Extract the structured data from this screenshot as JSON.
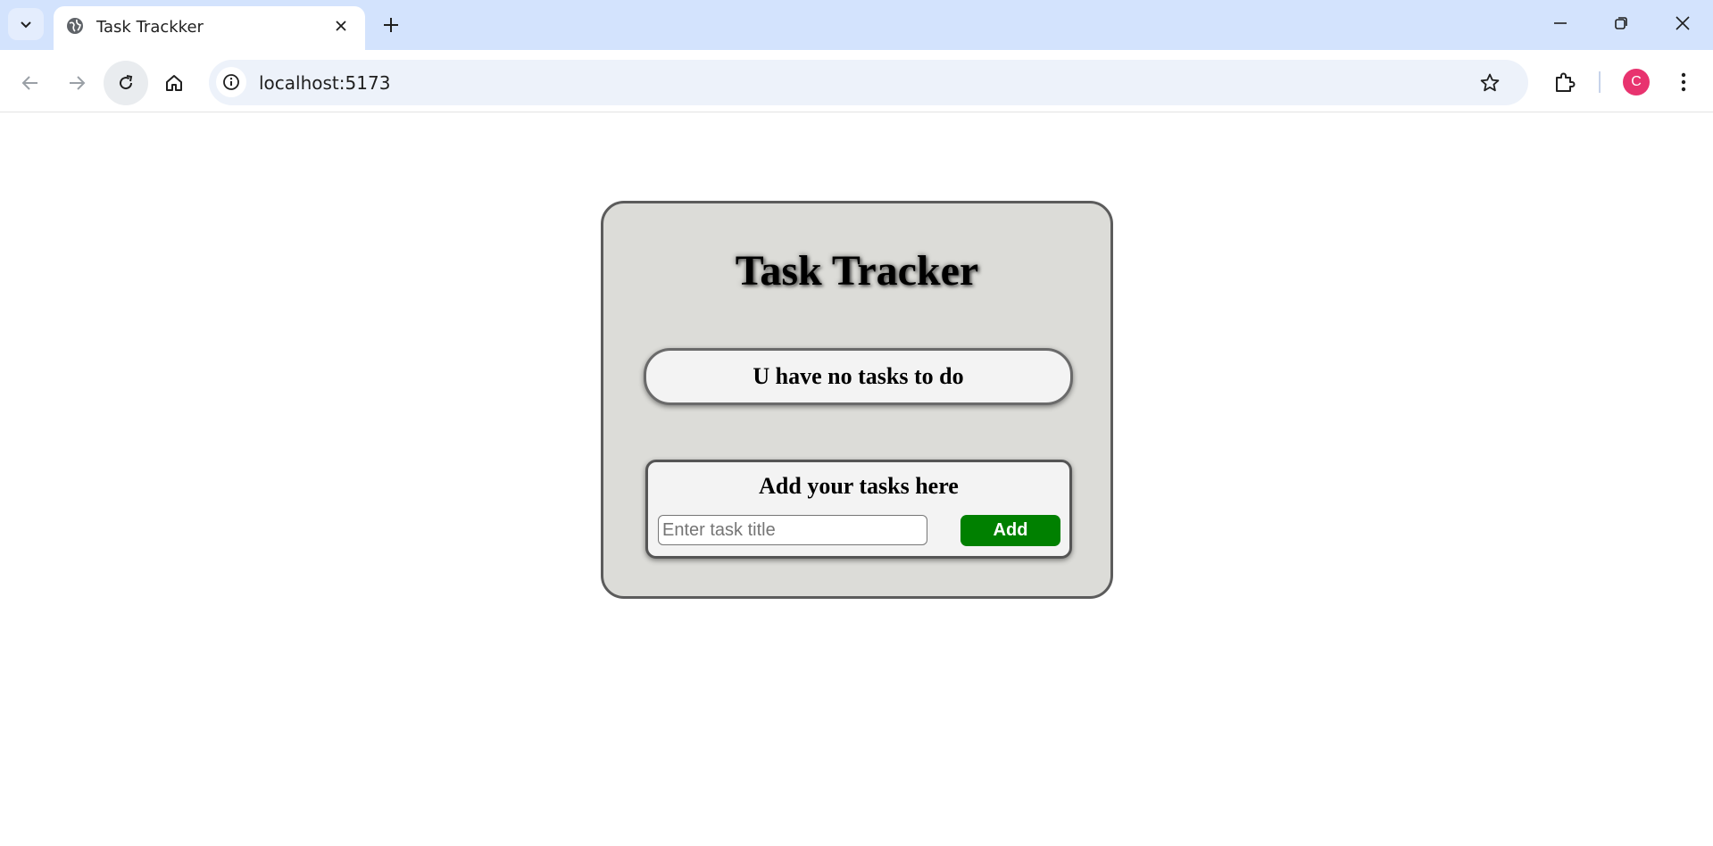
{
  "browser": {
    "tab_title": "Task Trackker",
    "url": "localhost:5173",
    "profile_initial": "C",
    "icons": {
      "tab_search": "chevron-down-icon",
      "favicon": "globe-icon",
      "tab_close": "close-icon",
      "new_tab": "plus-icon",
      "minimize": "minimize-icon",
      "restore": "restore-icon",
      "close_window": "close-icon",
      "back": "arrow-left-icon",
      "forward": "arrow-right-icon",
      "reload": "reload-icon",
      "home": "home-icon",
      "site_info": "info-icon",
      "bookmark": "star-icon",
      "extensions": "puzzle-icon",
      "menu": "kebab-menu-icon"
    },
    "colors": {
      "tabbar_bg": "#d3e3fd",
      "omnibox_bg": "#edf2fa",
      "avatar_bg": "#e8336f"
    }
  },
  "app": {
    "title": "Task Tracker",
    "empty_message": "U have no tasks to do",
    "add_section": {
      "heading": "Add your tasks here",
      "input_value": "",
      "input_placeholder": "Enter task title",
      "button_label": "Add"
    },
    "colors": {
      "card_bg": "#dcdcd8",
      "panel_bg": "#f3f3f3",
      "add_button_bg": "#008000"
    }
  }
}
